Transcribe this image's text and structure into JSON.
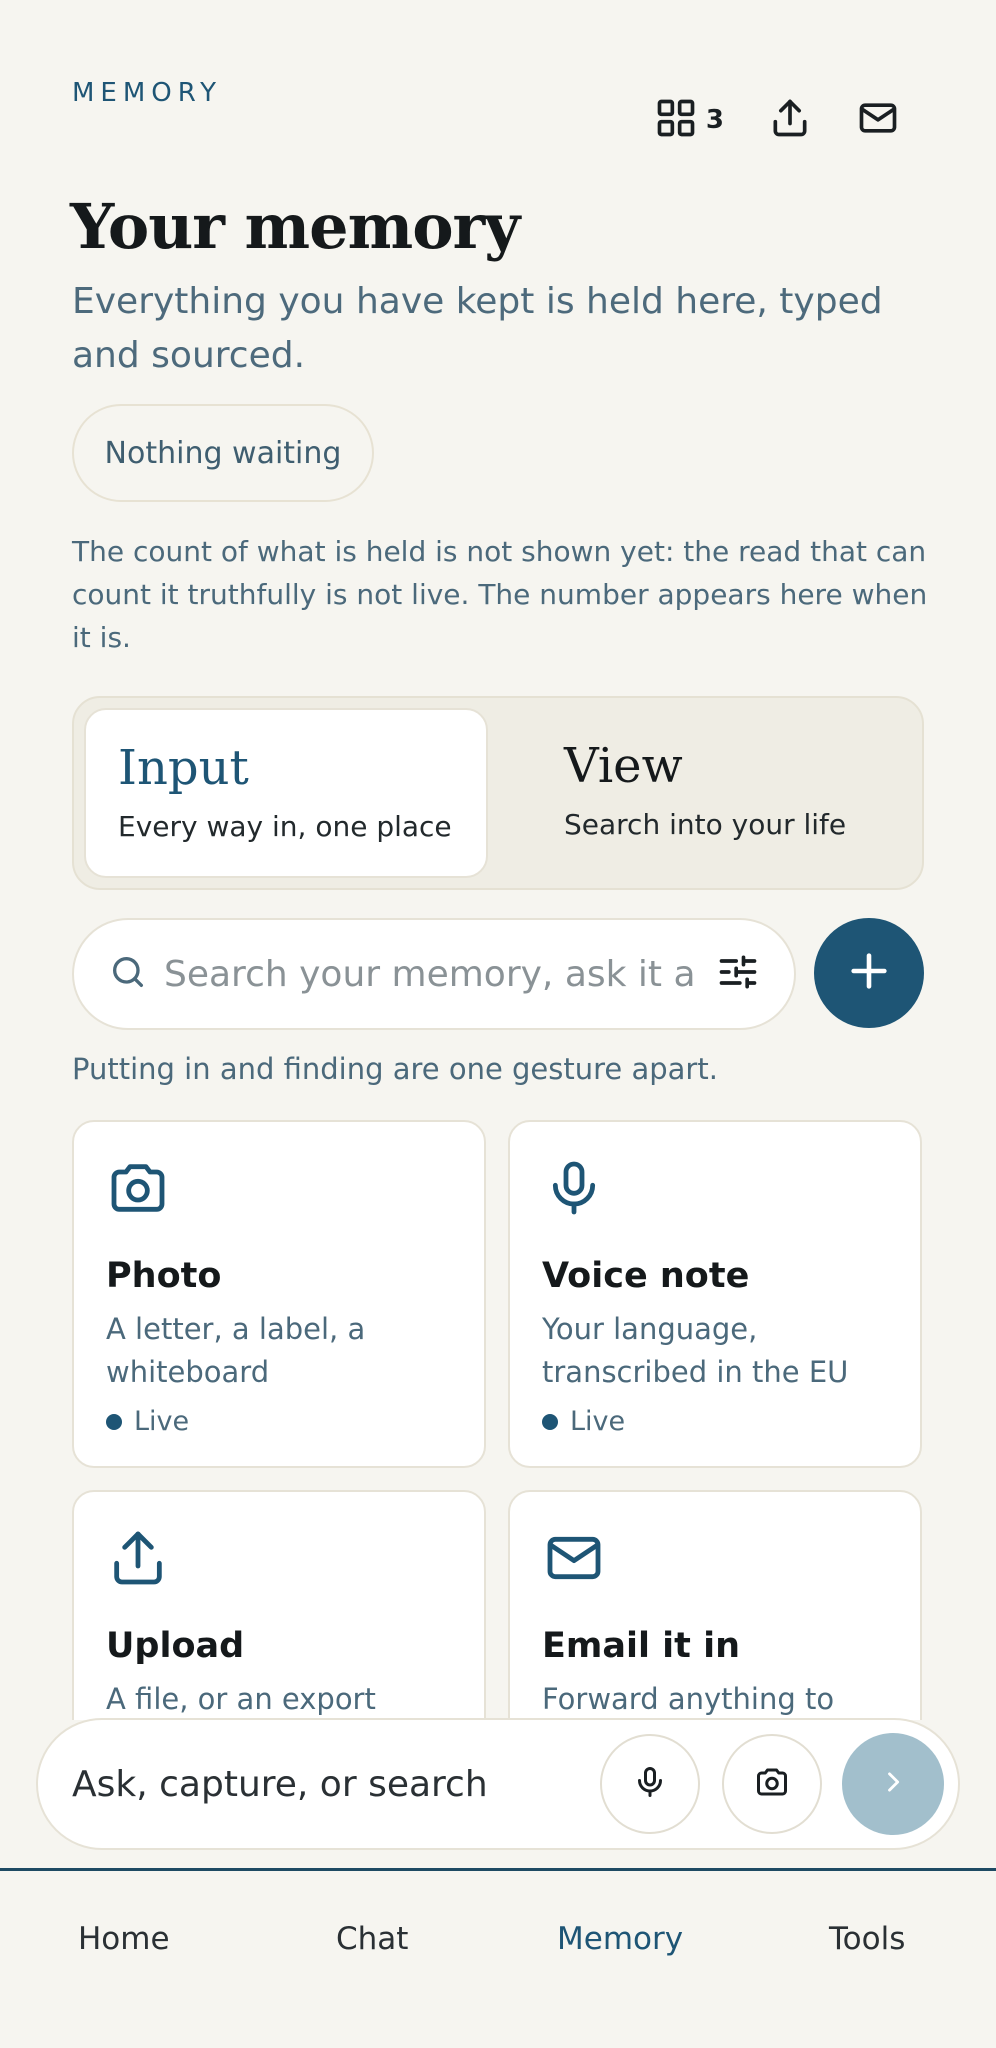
{
  "header": {
    "eyebrow": "MEMORY",
    "collections_count": "3",
    "title": "Your memory",
    "subtitle": "Everything you have kept is held here, typed and sourced.",
    "status_chip": "Nothing waiting",
    "note": "The count of what is held is not shown yet: the read that can count it truthfully is not live. The number appears here when it is."
  },
  "segments": [
    {
      "title": "Input",
      "desc": "Every way in, one place",
      "active": true
    },
    {
      "title": "View",
      "desc": "Search into your life",
      "active": false
    }
  ],
  "search": {
    "placeholder": "Search your memory, ask it anything"
  },
  "hint": "Putting in and finding are one gesture apart.",
  "cards": [
    {
      "title": "Photo",
      "desc": "A letter, a label, a whiteboard",
      "status": "Live",
      "icon": "camera-icon"
    },
    {
      "title": "Voice note",
      "desc": "Your language, transcribed in the EU",
      "status": "Live",
      "icon": "microphone-icon"
    },
    {
      "title": "Upload",
      "desc": "A file, or an export from",
      "icon": "upload-icon"
    },
    {
      "title": "Email it in",
      "desc": "Forward anything to",
      "icon": "mail-icon"
    }
  ],
  "composer": {
    "placeholder": "Ask, capture, or search"
  },
  "tabs": [
    {
      "label": "Home"
    },
    {
      "label": "Chat"
    },
    {
      "label": "Memory",
      "active": true
    },
    {
      "label": "Tools"
    }
  ],
  "colors": {
    "accent": "#1e5575",
    "background": "#f6f5f0",
    "send_disabled": "#a2bfcc"
  }
}
